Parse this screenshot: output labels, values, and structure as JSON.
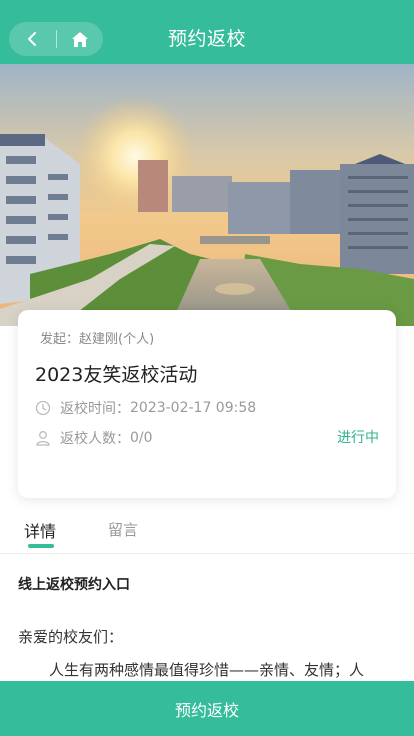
{
  "header": {
    "title": "预约返校",
    "back_icon": "chevron-left-icon",
    "home_icon": "home-icon"
  },
  "colors": {
    "accent": "#35bc9b",
    "status_active": "#2fb48f"
  },
  "event": {
    "initiator": "发起：赵建刚(个人)",
    "title": "2023友笑返校活动",
    "time_label": "返校时间：",
    "time_value": "2023-02-17 09:58",
    "count_label": "返校人数：",
    "count_value": "0/0",
    "status": "进行中"
  },
  "tabs": [
    {
      "label": "详情",
      "active": true
    },
    {
      "label": "留言",
      "active": false
    }
  ],
  "content": {
    "heading": "线上返校预约入口",
    "greeting": "亲爱的校友们：",
    "paragraph": "人生有两种感情最值得珍惜——亲情、友情；人"
  },
  "footer": {
    "action_label": "预约返校"
  }
}
